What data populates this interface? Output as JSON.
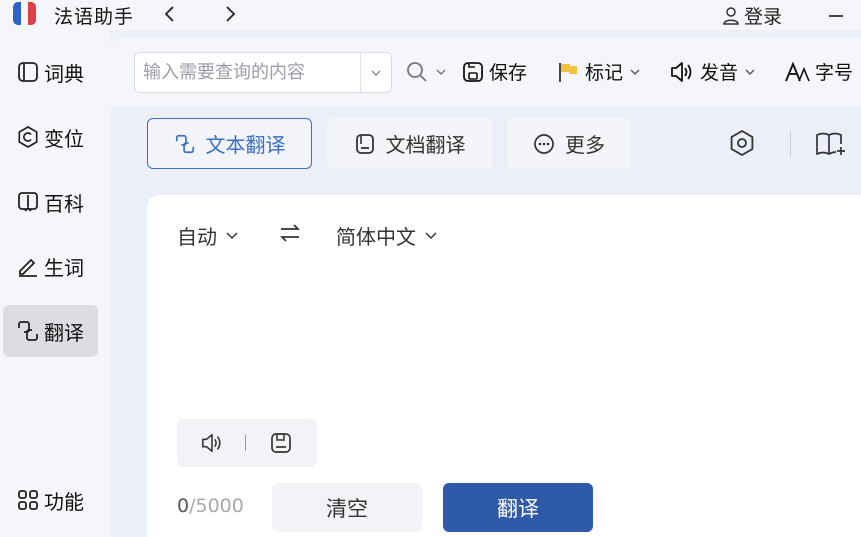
{
  "app": {
    "title": "法语助手",
    "login_label": "登录"
  },
  "sidebar": {
    "items": [
      {
        "label": "词典",
        "icon": "book-icon"
      },
      {
        "label": "变位",
        "icon": "c-circle-icon"
      },
      {
        "label": "百科",
        "icon": "open-book-icon"
      },
      {
        "label": "生词",
        "icon": "edit-icon"
      },
      {
        "label": "翻译",
        "icon": "translate-icon",
        "active": true
      },
      {
        "label": "功能",
        "icon": "grid-icon"
      }
    ]
  },
  "toolbar": {
    "search_placeholder": "输入需要查询的内容",
    "save_label": "保存",
    "mark_label": "标记",
    "pronounce_label": "发音",
    "fontsize_label": "字号"
  },
  "tabs": [
    {
      "label": "文本翻译",
      "active": true
    },
    {
      "label": "文档翻译",
      "active": false
    },
    {
      "label": "更多",
      "active": false
    }
  ],
  "translator": {
    "source_lang": "自动",
    "target_lang": "简体中文",
    "char_count": "0",
    "char_max": "/5000",
    "clear_label": "清空",
    "translate_label": "翻译"
  },
  "colors": {
    "accent": "#2f5aa8",
    "active_tab": "#3a6fc6",
    "flag": "#f2c33a"
  }
}
